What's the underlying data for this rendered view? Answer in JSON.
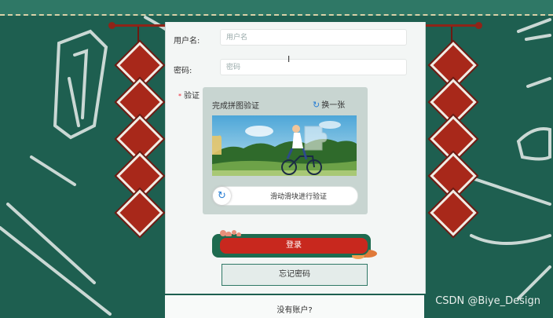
{
  "form": {
    "username_label": "用户名:",
    "username_placeholder": "用户名",
    "password_label": "密码:",
    "password_placeholder": "密码",
    "captcha_required_mark": "*",
    "captcha_label": "验证"
  },
  "captcha": {
    "title": "完成拼图验证",
    "refresh_label": "换一张",
    "slider_text": "滑动滑块进行验证",
    "refresh_icon": "refresh-icon"
  },
  "actions": {
    "login_label": "登录",
    "forgot_label": "忘记密码"
  },
  "footer": {
    "no_account": "没有账户?"
  },
  "watermark": "CSDN @Biye_Design",
  "colors": {
    "background": "#1e5f50",
    "accent_red": "#c8281e",
    "panel": "#f3f6f5"
  }
}
